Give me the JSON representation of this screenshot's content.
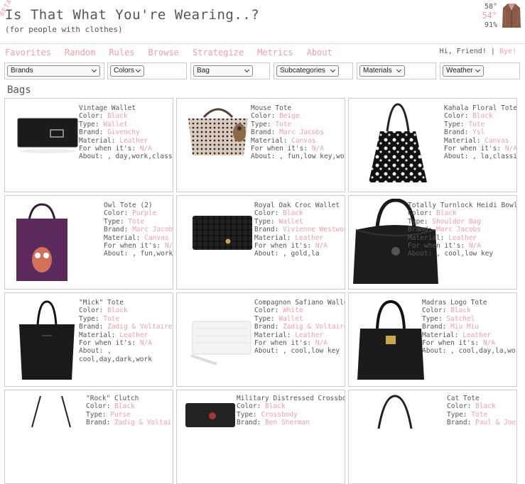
{
  "header": {
    "beta": "BETA",
    "title": "Is That What You're Wearing..?",
    "subtitle": "(for people with clothes)",
    "weather": {
      "high": "58°",
      "now": "54°",
      "humidity": "91%"
    }
  },
  "nav": {
    "links": [
      "Favorites",
      "Random",
      "Rules",
      "Browse",
      "Strategize",
      "Metrics",
      "About"
    ],
    "greeting": "Hi, Friend! |",
    "bye": "Bye!"
  },
  "filters": [
    "Brands",
    "Colors",
    "Bag",
    "Subcategories",
    "Materials",
    "Weather"
  ],
  "section_title": "Bags",
  "labels": {
    "color": "Color:",
    "type": "Type:",
    "brand": "Brand:",
    "material": "Material:",
    "when": "For when it's:",
    "about": "About:"
  },
  "items": [
    {
      "name": "Vintage Wallet",
      "color": "Black",
      "type": "Wallet",
      "brand": "Givenchy",
      "material": "Leather",
      "when": "N/A",
      "about": ", day,work,classic"
    },
    {
      "name": "Mouse Tote",
      "color": "Beige",
      "type": "Tote",
      "brand": "Marc Jacobs",
      "material": "Canvas",
      "when": "N/A",
      "about": ", fun,low key,work"
    },
    {
      "name": "Kahala Floral Tote",
      "color": "Black",
      "type": "Tote",
      "brand": "Ysl",
      "material": "Canvas",
      "when": "N/A",
      "about": ", la,classic"
    },
    {
      "name": "Owl Tote (2)",
      "color": "Purple",
      "type": "Tote",
      "brand": "Marc Jacobs",
      "material": "Canvas",
      "when": "N/A",
      "about": ", fun,work"
    },
    {
      "name": "Royal Oak Croc Wallet",
      "color": "Black",
      "type": "Wallet",
      "brand": "Vivienne Westwood",
      "material": "Leather",
      "when": "N/A",
      "about": ", gold,la"
    },
    {
      "name": "Totally Turnlock Heidi Bowler",
      "color": "Black",
      "type": "Shoulder Bag",
      "brand": "Marc Jacobs",
      "material": "Leather",
      "when": "N/A",
      "about": ", cool,low key"
    },
    {
      "name": "\"Mick\" Tote",
      "color": "Black",
      "type": "Tote",
      "brand": "Zadig & Voltaire",
      "material": "Leather",
      "when": "N/A",
      "about": ",",
      "about2": "cool,day,dark,work"
    },
    {
      "name": "Compagnon Safiano Wallet",
      "color": "White",
      "type": "Wallet",
      "brand": "Zadig & Voltaire",
      "material": "Leather",
      "when": "N/A",
      "about": ", cool,low key"
    },
    {
      "name": "Madras Logo Tote",
      "color": "Black",
      "type": "Satchel",
      "brand": "Miu Miu",
      "material": "Leather",
      "when": "N/A",
      "about": ", cool,day,la,work"
    },
    {
      "name": "\"Rock\" Clutch",
      "color": "Black",
      "type": "Purse",
      "brand": "Zadig & Voltaire",
      "material": "",
      "when": "",
      "about": ""
    },
    {
      "name": "Military Distressed Crossbody",
      "color": "Black",
      "type": "Crossbody",
      "brand": "Ben Sherman",
      "material": "",
      "when": "",
      "about": ""
    },
    {
      "name": "Cat Tote",
      "color": "Black",
      "type": "Tote",
      "brand": "Paul & Joe",
      "material": "",
      "when": "",
      "about": ""
    }
  ],
  "colors": {
    "accent": "#f0a0aa",
    "text": "#555555",
    "border": "#cccccc"
  }
}
